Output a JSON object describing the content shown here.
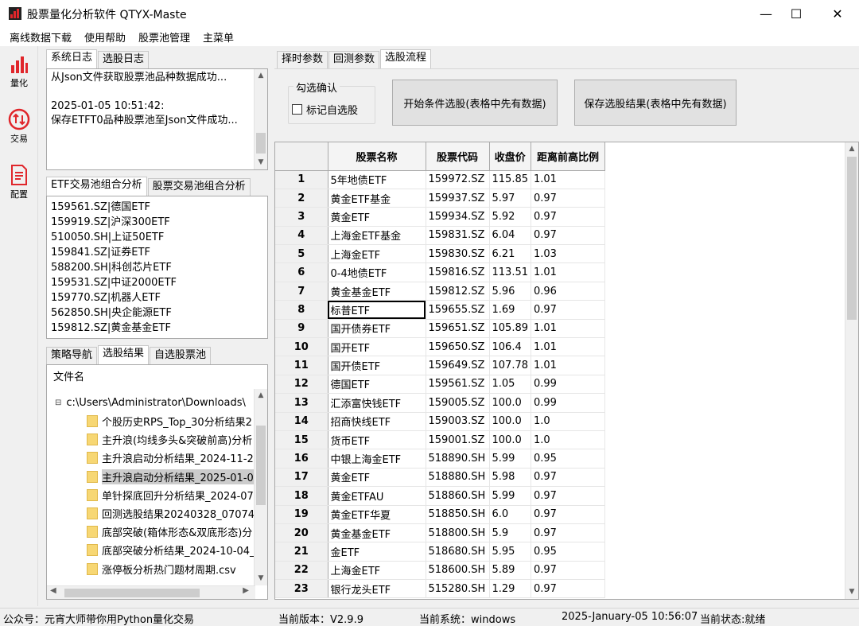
{
  "window": {
    "title": "股票量化分析软件 QTYX-Maste",
    "buttons": {
      "minimize": "—",
      "maximize": "☐",
      "close": "✕"
    }
  },
  "menu": [
    "离线数据下载",
    "使用帮助",
    "股票池管理",
    "主菜单"
  ],
  "toolbar": [
    {
      "label": "量化",
      "icon": "bar-chart-icon"
    },
    {
      "label": "交易",
      "icon": "trade-arrows-icon"
    },
    {
      "label": "配置",
      "icon": "document-icon"
    }
  ],
  "log_panel": {
    "tabs": [
      "系统日志",
      "选股日志"
    ],
    "text": "从Json文件获取股票池品种数据成功...\n\n2025-01-05 10:51:42:\n保存ETFT0品种股票池至Json文件成功..."
  },
  "pool_panel": {
    "tabs": [
      "ETF交易池组合分析",
      "股票交易池组合分析"
    ],
    "items": [
      "159561.SZ|德国ETF",
      "159919.SZ|沪深300ETF",
      "510050.SH|上证50ETF",
      "159841.SZ|证券ETF",
      "588200.SH|科创芯片ETF",
      "159531.SZ|中证2000ETF",
      "159770.SZ|机器人ETF",
      "562850.SH|央企能源ETF",
      "159812.SZ|黄金基金ETF"
    ]
  },
  "result_panel": {
    "tabs": [
      "策略导航",
      "选股结果",
      "自选股票池"
    ],
    "header": "文件名",
    "root": "c:\\Users\\Administrator\\Downloads\\",
    "files": [
      "个股历史RPS_Top_30分析结果2",
      "主升浪(均线多头&突破前高)分析",
      "主升浪启动分析结果_2024-11-2",
      "主升浪启动分析结果_2025-01-0",
      "单针探底回升分析结果_2024-07",
      "回测选股结果20240328_070745",
      "底部突破(箱体形态&双底形态)分",
      "底部突破分析结果_2024-10-04_",
      "涨停板分析热门题材周期.csv"
    ],
    "selected_index": 3
  },
  "right_tabs": [
    "择时参数",
    "回测参数",
    "选股流程"
  ],
  "confirm_group": {
    "title": "勾选确认",
    "checkbox_label": "标记自选股",
    "checked": false
  },
  "buttons": {
    "start": "开始条件选股(表格中先有数据)",
    "save": "保存选股结果(表格中先有数据)"
  },
  "table": {
    "columns": [
      "股票名称",
      "股票代码",
      "收盘价",
      "距离前高比例"
    ],
    "selected_row": 8,
    "rows": [
      {
        "n": "1",
        "name": "5年地债ETF",
        "code": "159972.SZ",
        "close": "115.85",
        "ratio": "1.01"
      },
      {
        "n": "2",
        "name": "黄金ETF基金",
        "code": "159937.SZ",
        "close": "5.97",
        "ratio": "0.97"
      },
      {
        "n": "3",
        "name": "黄金ETF",
        "code": "159934.SZ",
        "close": "5.92",
        "ratio": "0.97"
      },
      {
        "n": "4",
        "name": "上海金ETF基金",
        "code": "159831.SZ",
        "close": "6.04",
        "ratio": "0.97"
      },
      {
        "n": "5",
        "name": "上海金ETF",
        "code": "159830.SZ",
        "close": "6.21",
        "ratio": "1.03"
      },
      {
        "n": "6",
        "name": "0-4地债ETF",
        "code": "159816.SZ",
        "close": "113.51",
        "ratio": "1.01"
      },
      {
        "n": "7",
        "name": "黄金基金ETF",
        "code": "159812.SZ",
        "close": "5.96",
        "ratio": "0.96"
      },
      {
        "n": "8",
        "name": "标普ETF",
        "code": "159655.SZ",
        "close": "1.69",
        "ratio": "0.97"
      },
      {
        "n": "9",
        "name": "国开债券ETF",
        "code": "159651.SZ",
        "close": "105.89",
        "ratio": "1.01"
      },
      {
        "n": "10",
        "name": "国开ETF",
        "code": "159650.SZ",
        "close": "106.4",
        "ratio": "1.01"
      },
      {
        "n": "11",
        "name": "国开债ETF",
        "code": "159649.SZ",
        "close": "107.78",
        "ratio": "1.01"
      },
      {
        "n": "12",
        "name": "德国ETF",
        "code": "159561.SZ",
        "close": "1.05",
        "ratio": "0.99"
      },
      {
        "n": "13",
        "name": "汇添富快钱ETF",
        "code": "159005.SZ",
        "close": "100.0",
        "ratio": "0.99"
      },
      {
        "n": "14",
        "name": "招商快线ETF",
        "code": "159003.SZ",
        "close": "100.0",
        "ratio": "1.0"
      },
      {
        "n": "15",
        "name": "货币ETF",
        "code": "159001.SZ",
        "close": "100.0",
        "ratio": "1.0"
      },
      {
        "n": "16",
        "name": "中银上海金ETF",
        "code": "518890.SH",
        "close": "5.99",
        "ratio": "0.95"
      },
      {
        "n": "17",
        "name": "黄金ETF",
        "code": "518880.SH",
        "close": "5.98",
        "ratio": "0.97"
      },
      {
        "n": "18",
        "name": "黄金ETFAU",
        "code": "518860.SH",
        "close": "5.99",
        "ratio": "0.97"
      },
      {
        "n": "19",
        "name": "黄金ETF华夏",
        "code": "518850.SH",
        "close": "6.0",
        "ratio": "0.97"
      },
      {
        "n": "20",
        "name": "黄金基金ETF",
        "code": "518800.SH",
        "close": "5.9",
        "ratio": "0.97"
      },
      {
        "n": "21",
        "name": "金ETF",
        "code": "518680.SH",
        "close": "5.95",
        "ratio": "0.95"
      },
      {
        "n": "22",
        "name": "上海金ETF",
        "code": "518600.SH",
        "close": "5.89",
        "ratio": "0.97"
      },
      {
        "n": "23",
        "name": "银行龙头ETF",
        "code": "515280.SH",
        "close": "1.29",
        "ratio": "0.97"
      }
    ]
  },
  "status": {
    "wechat": "公众号：元宵大师带你用Python量化交易",
    "version": "当前版本：V2.9.9",
    "system": "当前系统：windows",
    "datetime": "2025-January-05 10:56:07",
    "state": "当前状态:就绪"
  },
  "colors": {
    "accent_red": "#e0262b",
    "folder_yellow": "#f7d774",
    "selection": "#cce8ff"
  }
}
